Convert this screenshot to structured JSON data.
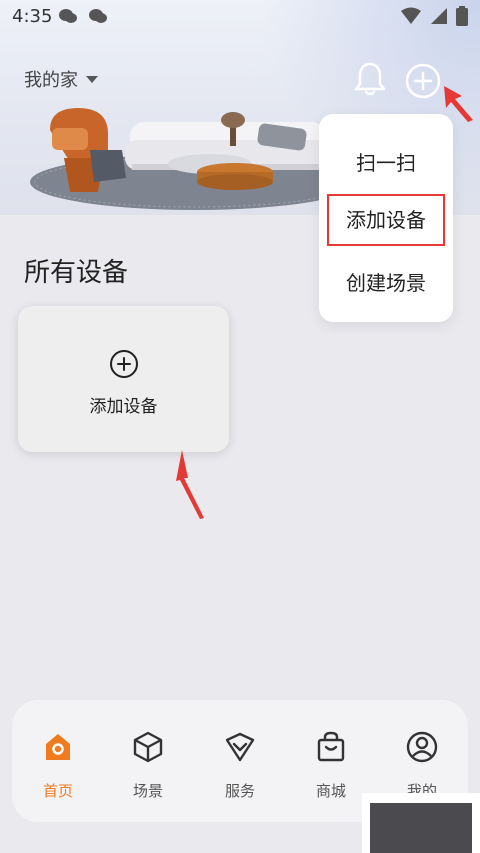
{
  "status_bar": {
    "time": "4:35"
  },
  "header": {
    "home_title": "我的家"
  },
  "popup_menu": {
    "items": [
      {
        "label": "扫一扫"
      },
      {
        "label": "添加设备"
      },
      {
        "label": "创建场景"
      }
    ]
  },
  "main": {
    "section_title": "所有设备",
    "add_device_label": "添加设备"
  },
  "bottom_nav": {
    "items": [
      {
        "label": "首页",
        "icon": "home-icon",
        "active": true
      },
      {
        "label": "场景",
        "icon": "cube-icon",
        "active": false
      },
      {
        "label": "服务",
        "icon": "shield-heart-icon",
        "active": false
      },
      {
        "label": "商城",
        "icon": "shopping-bag-icon",
        "active": false
      },
      {
        "label": "我的",
        "icon": "user-icon",
        "active": false
      }
    ]
  },
  "colors": {
    "accent": "#f07a1e",
    "annotation_red": "#e53935"
  }
}
